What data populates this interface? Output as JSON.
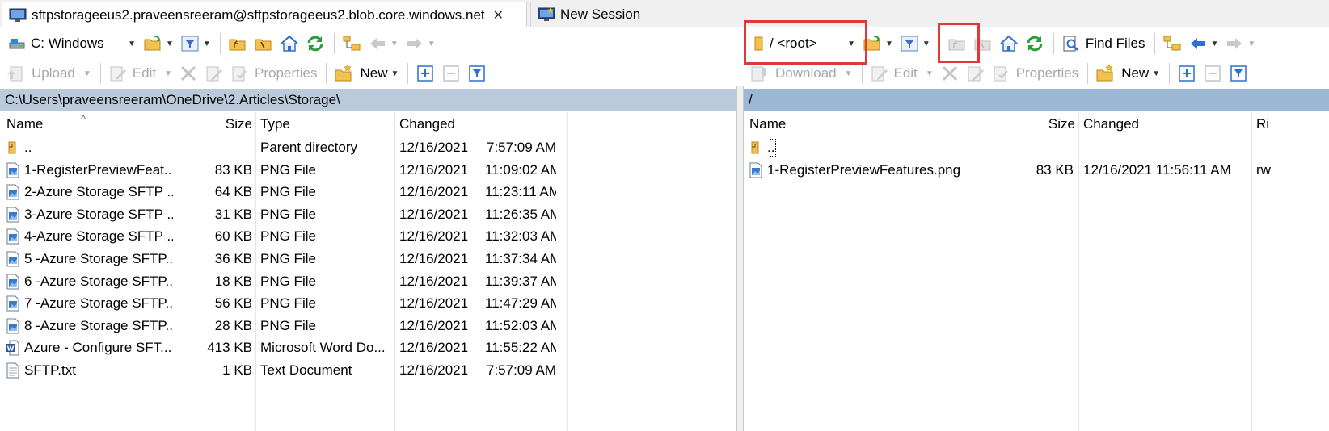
{
  "tabs": {
    "active_label": "sftpstorageeus2.praveensreeram@sftpstorageeus2.blob.core.windows.net",
    "new_session_label": "New Session",
    "close_glyph": "✕"
  },
  "left_toolbar": {
    "drive_label": "C: Windows",
    "upload_label": "Upload",
    "edit_label": "Edit",
    "properties_label": "Properties",
    "new_label": "New"
  },
  "right_toolbar": {
    "path_label": "/ <root>",
    "find_files_label": "Find Files",
    "download_label": "Download",
    "edit_label": "Edit",
    "properties_label": "Properties",
    "new_label": "New"
  },
  "left_panel": {
    "path": "C:\\Users\\praveensreeram\\OneDrive\\2.Articles\\Storage\\",
    "columns": {
      "name": "Name",
      "size": "Size",
      "type": "Type",
      "changed": "Changed"
    },
    "rows": [
      {
        "name": "..",
        "size": "",
        "type": "Parent directory",
        "date": "12/16/2021",
        "time": "7:57:09 AM",
        "icon": "parent-folder-icon"
      },
      {
        "name": "1-RegisterPreviewFeat...",
        "size": "83 KB",
        "type": "PNG File",
        "date": "12/16/2021",
        "time": "11:09:02 AM",
        "icon": "png-file-icon"
      },
      {
        "name": "2-Azure Storage SFTP ...",
        "size": "64 KB",
        "type": "PNG File",
        "date": "12/16/2021",
        "time": "11:23:11 AM",
        "icon": "png-file-icon"
      },
      {
        "name": "3-Azure Storage SFTP ...",
        "size": "31 KB",
        "type": "PNG File",
        "date": "12/16/2021",
        "time": "11:26:35 AM",
        "icon": "png-file-icon"
      },
      {
        "name": "4-Azure Storage SFTP ...",
        "size": "60 KB",
        "type": "PNG File",
        "date": "12/16/2021",
        "time": "11:32:03 AM",
        "icon": "png-file-icon"
      },
      {
        "name": "5 -Azure Storage SFTP...",
        "size": "36 KB",
        "type": "PNG File",
        "date": "12/16/2021",
        "time": "11:37:34 AM",
        "icon": "png-file-icon"
      },
      {
        "name": "6 -Azure Storage SFTP...",
        "size": "18 KB",
        "type": "PNG File",
        "date": "12/16/2021",
        "time": "11:39:37 AM",
        "icon": "png-file-icon"
      },
      {
        "name": "7 -Azure Storage SFTP...",
        "size": "56 KB",
        "type": "PNG File",
        "date": "12/16/2021",
        "time": "11:47:29 AM",
        "icon": "png-file-icon"
      },
      {
        "name": "8 -Azure Storage SFTP...",
        "size": "28 KB",
        "type": "PNG File",
        "date": "12/16/2021",
        "time": "11:52:03 AM",
        "icon": "png-file-icon"
      },
      {
        "name": "Azure - Configure SFT...",
        "size": "413 KB",
        "type": "Microsoft Word Do...",
        "date": "12/16/2021",
        "time": "11:55:22 AM",
        "icon": "word-file-icon"
      },
      {
        "name": "SFTP.txt",
        "size": "1 KB",
        "type": "Text Document",
        "date": "12/16/2021",
        "time": "7:57:09 AM",
        "icon": "text-file-icon"
      }
    ]
  },
  "right_panel": {
    "path": "/",
    "columns": {
      "name": "Name",
      "size": "Size",
      "changed": "Changed",
      "rights": "Ri"
    },
    "rows": [
      {
        "name": "..",
        "size": "",
        "changed": "",
        "rights": "",
        "icon": "parent-folder-icon"
      },
      {
        "name": "1-RegisterPreviewFeatures.png",
        "size": "83 KB",
        "changed": "12/16/2021 11:56:11 AM",
        "rights": "rw",
        "icon": "png-file-icon"
      }
    ]
  },
  "colors": {
    "left_path_bg": "#bccbdb",
    "right_path_bg": "#9db7d6",
    "highlight_box": "#e0393b",
    "folder": "#f2c14e",
    "refresh_green": "#2e9b3b",
    "nav_blue": "#2f6fd1"
  }
}
